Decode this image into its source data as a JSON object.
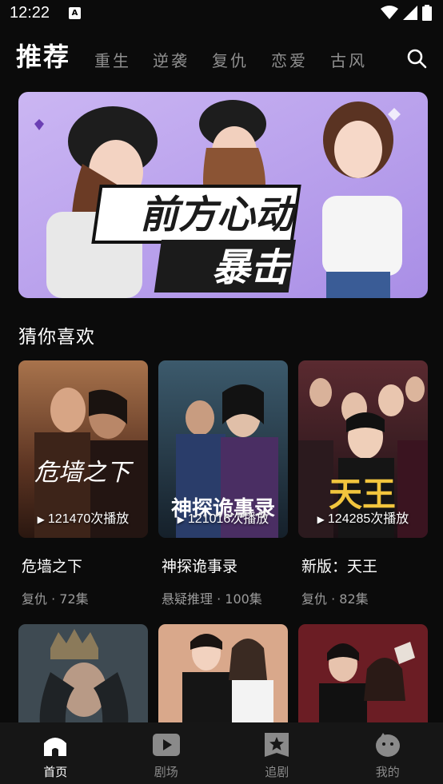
{
  "status_bar": {
    "time": "12:22",
    "app_icon_glyph": "A"
  },
  "header": {
    "title": "推荐",
    "tabs": [
      "重生",
      "逆袭",
      "复仇",
      "恋爱",
      "古风"
    ]
  },
  "banner": {
    "title_line1": "前方心动",
    "title_line2": "暴击"
  },
  "section": {
    "title": "猜你喜欢"
  },
  "cards": [
    {
      "title": "危墙之下",
      "meta": "复仇 · 72集",
      "plays": "121470次播放",
      "poster_text": "危墙之下"
    },
    {
      "title": "神探诡事录",
      "meta": "悬疑推理 · 100集",
      "plays": "121016次播放",
      "poster_text": "神探诡事录"
    },
    {
      "title": "新版：天王",
      "meta": "复仇 · 82集",
      "plays": "124285次播放",
      "poster_text": "天王"
    }
  ],
  "bottom_nav": [
    {
      "label": "首页",
      "icon": "home-icon",
      "active": true
    },
    {
      "label": "剧场",
      "icon": "play-icon",
      "active": false
    },
    {
      "label": "追剧",
      "icon": "star-icon",
      "active": false
    },
    {
      "label": "我的",
      "icon": "profile-icon",
      "active": false
    }
  ],
  "colors": {
    "background": "#0b0b0b",
    "bottom_nav_bg": "#161616",
    "inactive_text": "#8f8f8f"
  }
}
